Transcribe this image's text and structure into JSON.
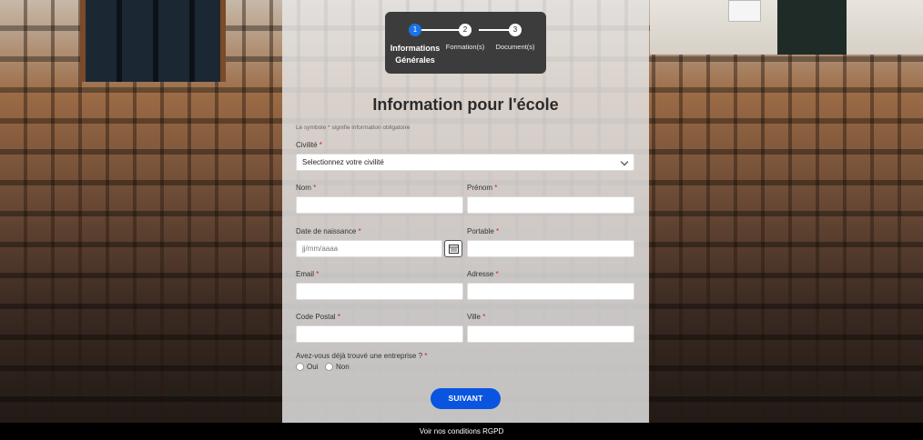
{
  "stepper": {
    "steps": [
      {
        "number": "1",
        "label_line1": "Informations",
        "label_line2": "Générales",
        "active": true
      },
      {
        "number": "2",
        "label_line1": "Formation(s)",
        "label_line2": "",
        "active": false
      },
      {
        "number": "3",
        "label_line1": "Document(s)",
        "label_line2": "",
        "active": false
      }
    ]
  },
  "form": {
    "title": "Information pour l'école",
    "hint": "Le symbole * signifie information obligatoire",
    "required_marker": "*",
    "civilite": {
      "label": "Civilité",
      "value": "Selectionnez votre civilité"
    },
    "nom": {
      "label": "Nom",
      "value": ""
    },
    "prenom": {
      "label": "Prénom",
      "value": ""
    },
    "date_naissance": {
      "label": "Date de naissance",
      "placeholder": "jj/mm/aaaa"
    },
    "portable": {
      "label": "Portable",
      "value": ""
    },
    "email": {
      "label": "Email",
      "value": ""
    },
    "adresse": {
      "label": "Adresse",
      "value": ""
    },
    "code_postal": {
      "label": "Code Postal",
      "value": ""
    },
    "ville": {
      "label": "Ville",
      "value": ""
    },
    "entreprise": {
      "label": "Avez-vous déjà trouvé une entreprise ?",
      "options": [
        "Oui",
        "Non"
      ]
    },
    "submit_label": "SUIVANT"
  },
  "footer": {
    "text": "Voir nos conditions RGPD"
  },
  "colors": {
    "accent": "#0a55e0",
    "step_active": "#1a73e8",
    "required": "#d02020"
  }
}
